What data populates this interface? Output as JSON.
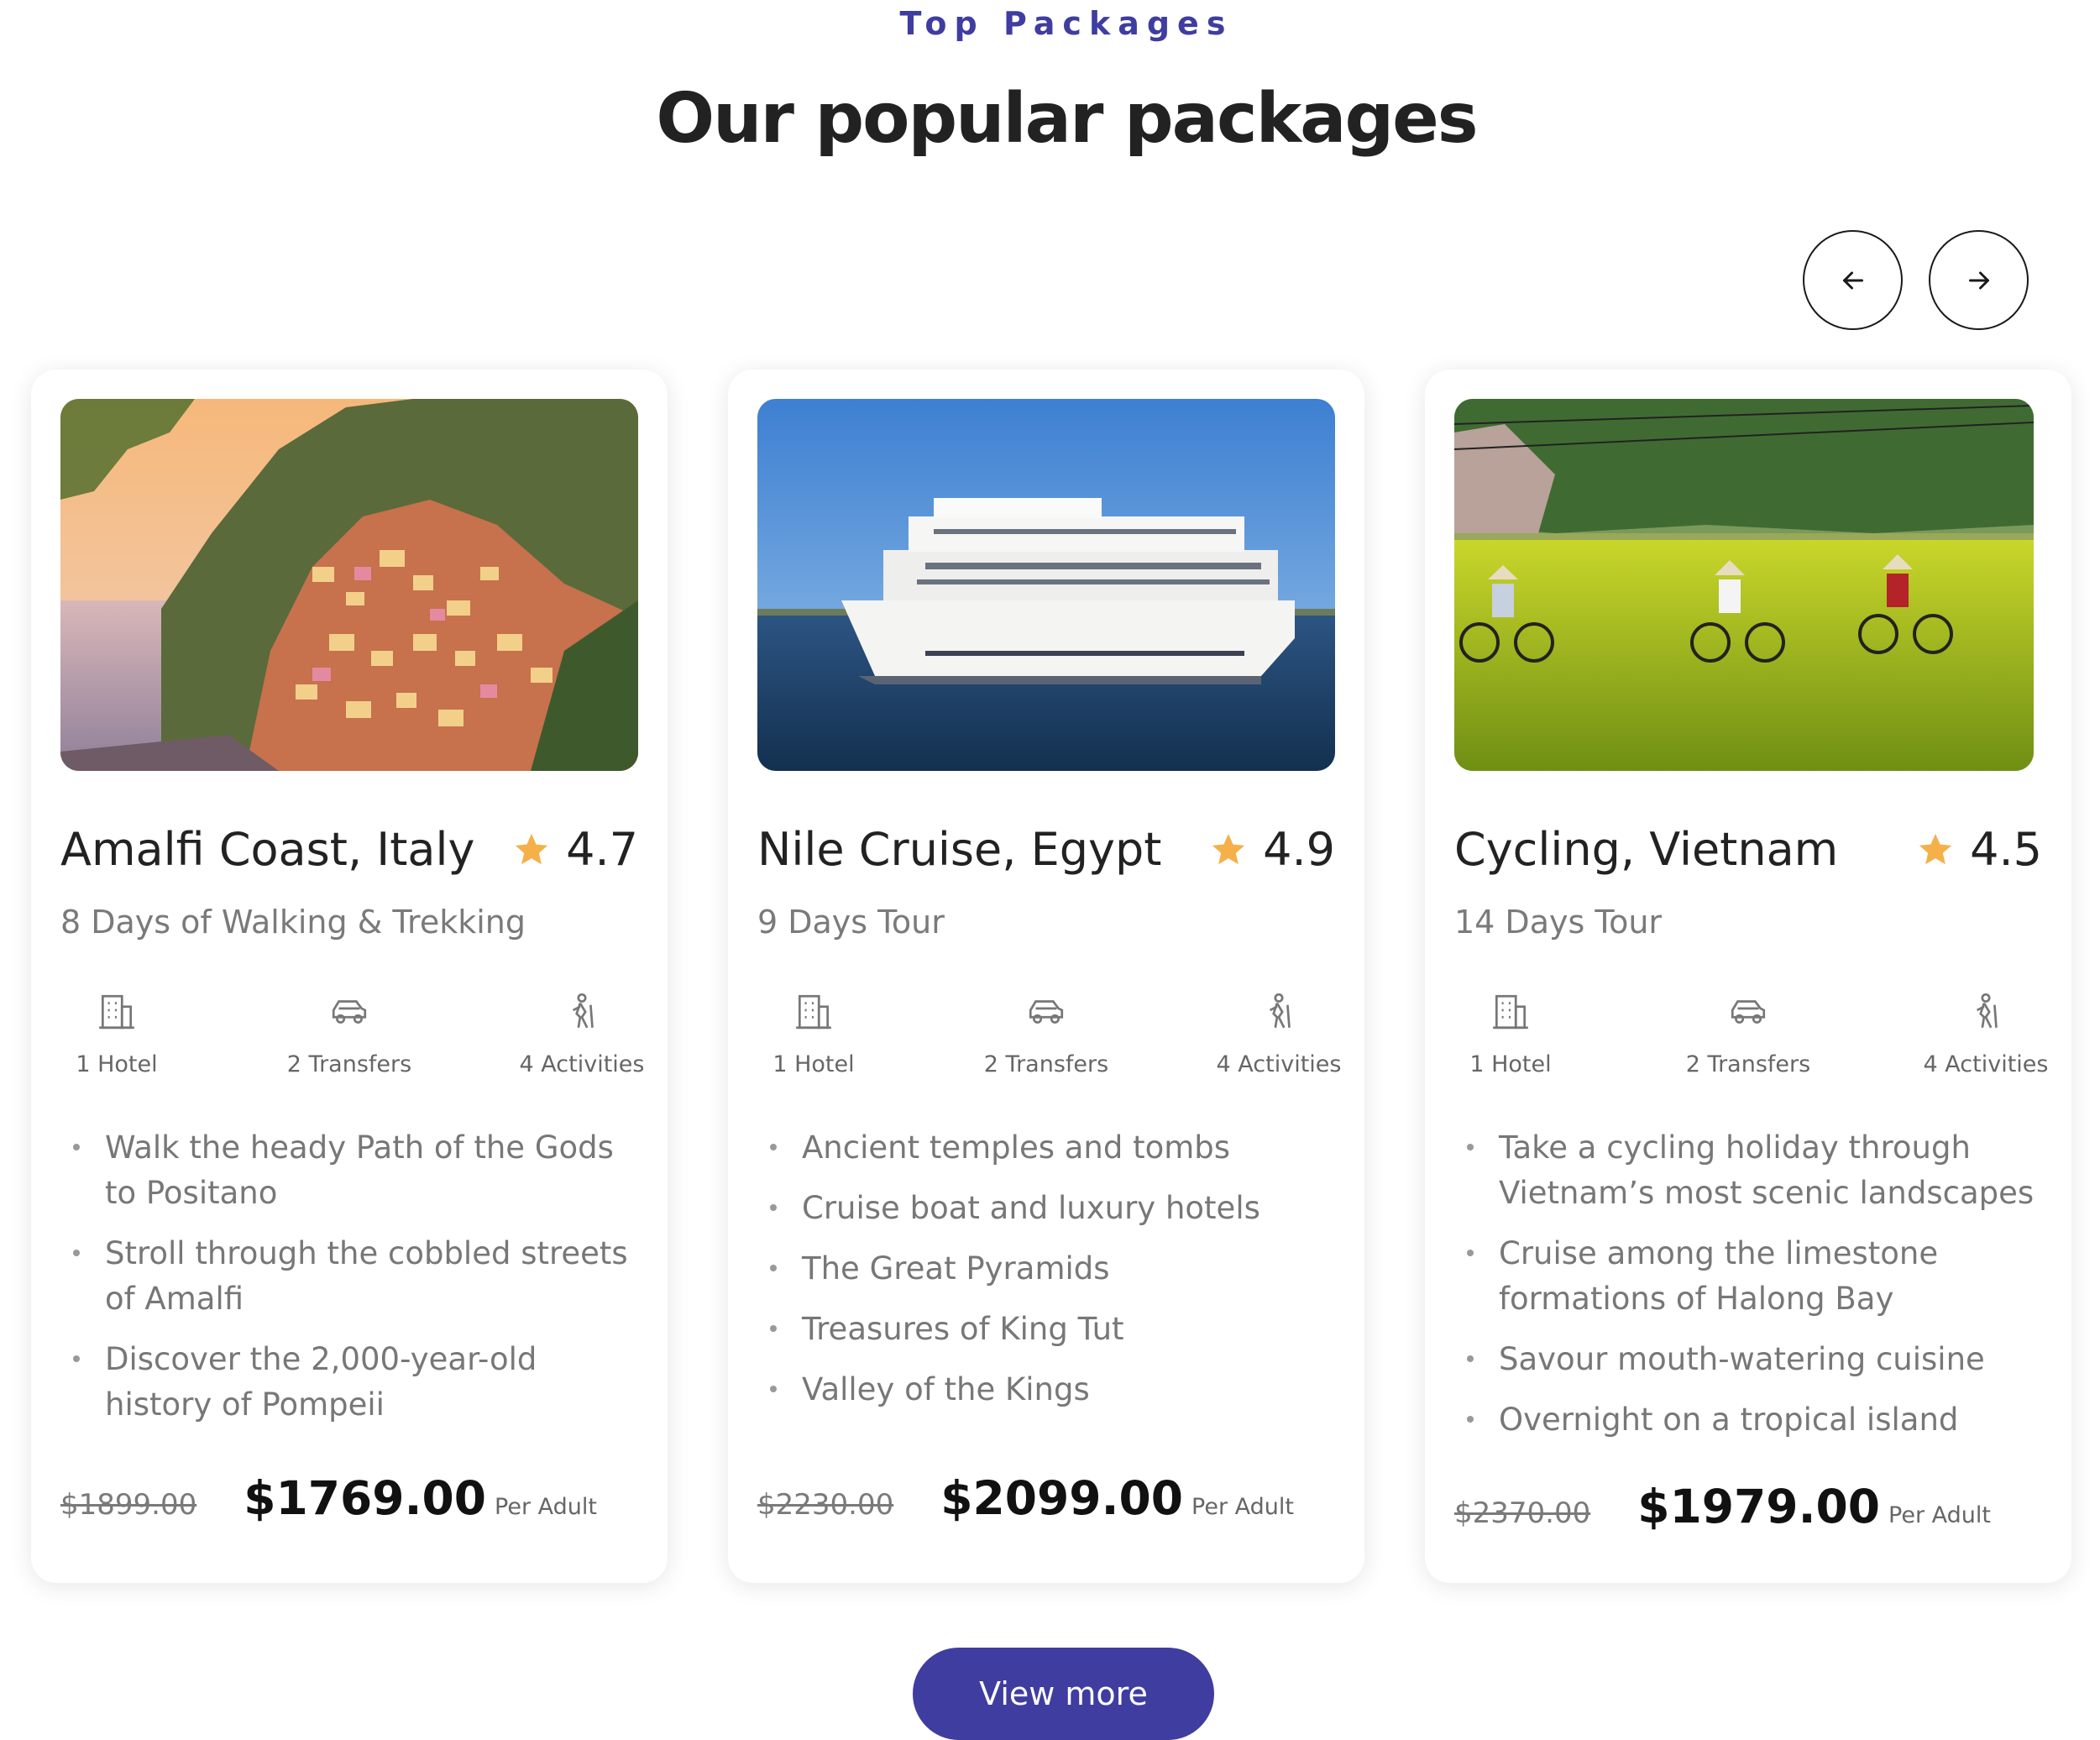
{
  "section": {
    "eyebrow": "Top Packages",
    "title": "Our popular packages"
  },
  "carousel": {
    "prev_icon": "arrow-left-icon",
    "next_icon": "arrow-right-icon"
  },
  "colors": {
    "accent": "#3f3da0",
    "star": "#f5b04a"
  },
  "packages": [
    {
      "image_icon": "amalfi-coast-photo",
      "title": "Amalfi Coast, Italy",
      "rating": "4.7",
      "duration": "8 Days of Walking & Trekking",
      "features": [
        {
          "icon": "hotel-icon",
          "label": "1 Hotel"
        },
        {
          "icon": "car-icon",
          "label": "2 Transfers"
        },
        {
          "icon": "hiker-icon",
          "label": "4 Activities"
        }
      ],
      "highlights": [
        "Walk the heady Path of the Gods to Positano",
        "Stroll through the cobbled streets of Amalfi",
        "Discover the 2,000-year-old history of Pompeii"
      ],
      "old_price": "$1899.00",
      "price": "$1769.00",
      "price_unit": "Per Adult"
    },
    {
      "image_icon": "nile-cruise-photo",
      "title": "Nile Cruise, Egypt",
      "rating": "4.9",
      "duration": "9 Days Tour",
      "features": [
        {
          "icon": "hotel-icon",
          "label": "1 Hotel"
        },
        {
          "icon": "car-icon",
          "label": "2 Transfers"
        },
        {
          "icon": "hiker-icon",
          "label": "4 Activities"
        }
      ],
      "highlights": [
        "Ancient temples and tombs",
        "Cruise boat and luxury hotels",
        "The Great Pyramids",
        "Treasures of King Tut",
        "Valley of the Kings"
      ],
      "old_price": "$2230.00",
      "price": "$2099.00",
      "price_unit": "Per Adult"
    },
    {
      "image_icon": "cycling-vietnam-photo",
      "title": "Cycling, Vietnam",
      "rating": "4.5",
      "duration": "14 Days Tour",
      "features": [
        {
          "icon": "hotel-icon",
          "label": "1 Hotel"
        },
        {
          "icon": "car-icon",
          "label": "2 Transfers"
        },
        {
          "icon": "hiker-icon",
          "label": "4 Activities"
        }
      ],
      "highlights": [
        "Take a cycling holiday through Vietnam’s most scenic landscapes",
        "Cruise among the limestone formations of Halong Bay",
        "Savour mouth-watering cuisine",
        "Overnight on a tropical island"
      ],
      "old_price": "$2370.00",
      "price": "$1979.00",
      "price_unit": "Per Adult"
    }
  ],
  "cta": {
    "label": "View more"
  }
}
